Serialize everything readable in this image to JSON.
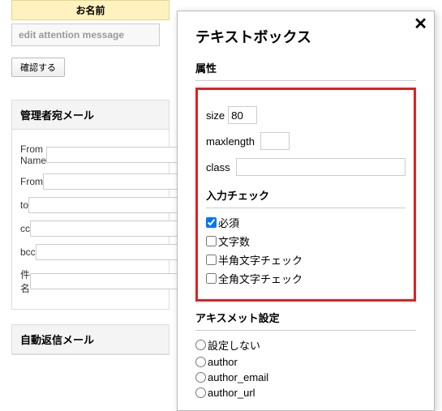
{
  "left": {
    "name_header": "お名前",
    "attention_placeholder": "edit attention message",
    "confirm_button": "確認する",
    "admin_mail_title": "管理者宛メール",
    "fields": [
      {
        "label": "From Name",
        "value": ""
      },
      {
        "label": "From",
        "value": ""
      },
      {
        "label": "to",
        "value": ""
      },
      {
        "label": "cc",
        "value": ""
      },
      {
        "label": "bcc",
        "value": ""
      },
      {
        "label": "件名",
        "value": ""
      }
    ],
    "auto_reply_title": "自動返信メール"
  },
  "modal": {
    "title": "テキストボックス",
    "attr_title": "属性",
    "attrs": {
      "size": {
        "label": "size",
        "value": "80"
      },
      "maxlength": {
        "label": "maxlength",
        "value": ""
      },
      "class": {
        "label": "class",
        "value": ""
      }
    },
    "validation_title": "入力チェック",
    "validations": [
      {
        "label": "必須",
        "checked": true
      },
      {
        "label": "文字数",
        "checked": false
      },
      {
        "label": "半角文字チェック",
        "checked": false
      },
      {
        "label": "全角文字チェック",
        "checked": false
      }
    ],
    "akismet_title": "アキスメット設定",
    "akismet_options": [
      {
        "label": "設定しない"
      },
      {
        "label": "author"
      },
      {
        "label": "author_email"
      },
      {
        "label": "author_url"
      }
    ]
  }
}
